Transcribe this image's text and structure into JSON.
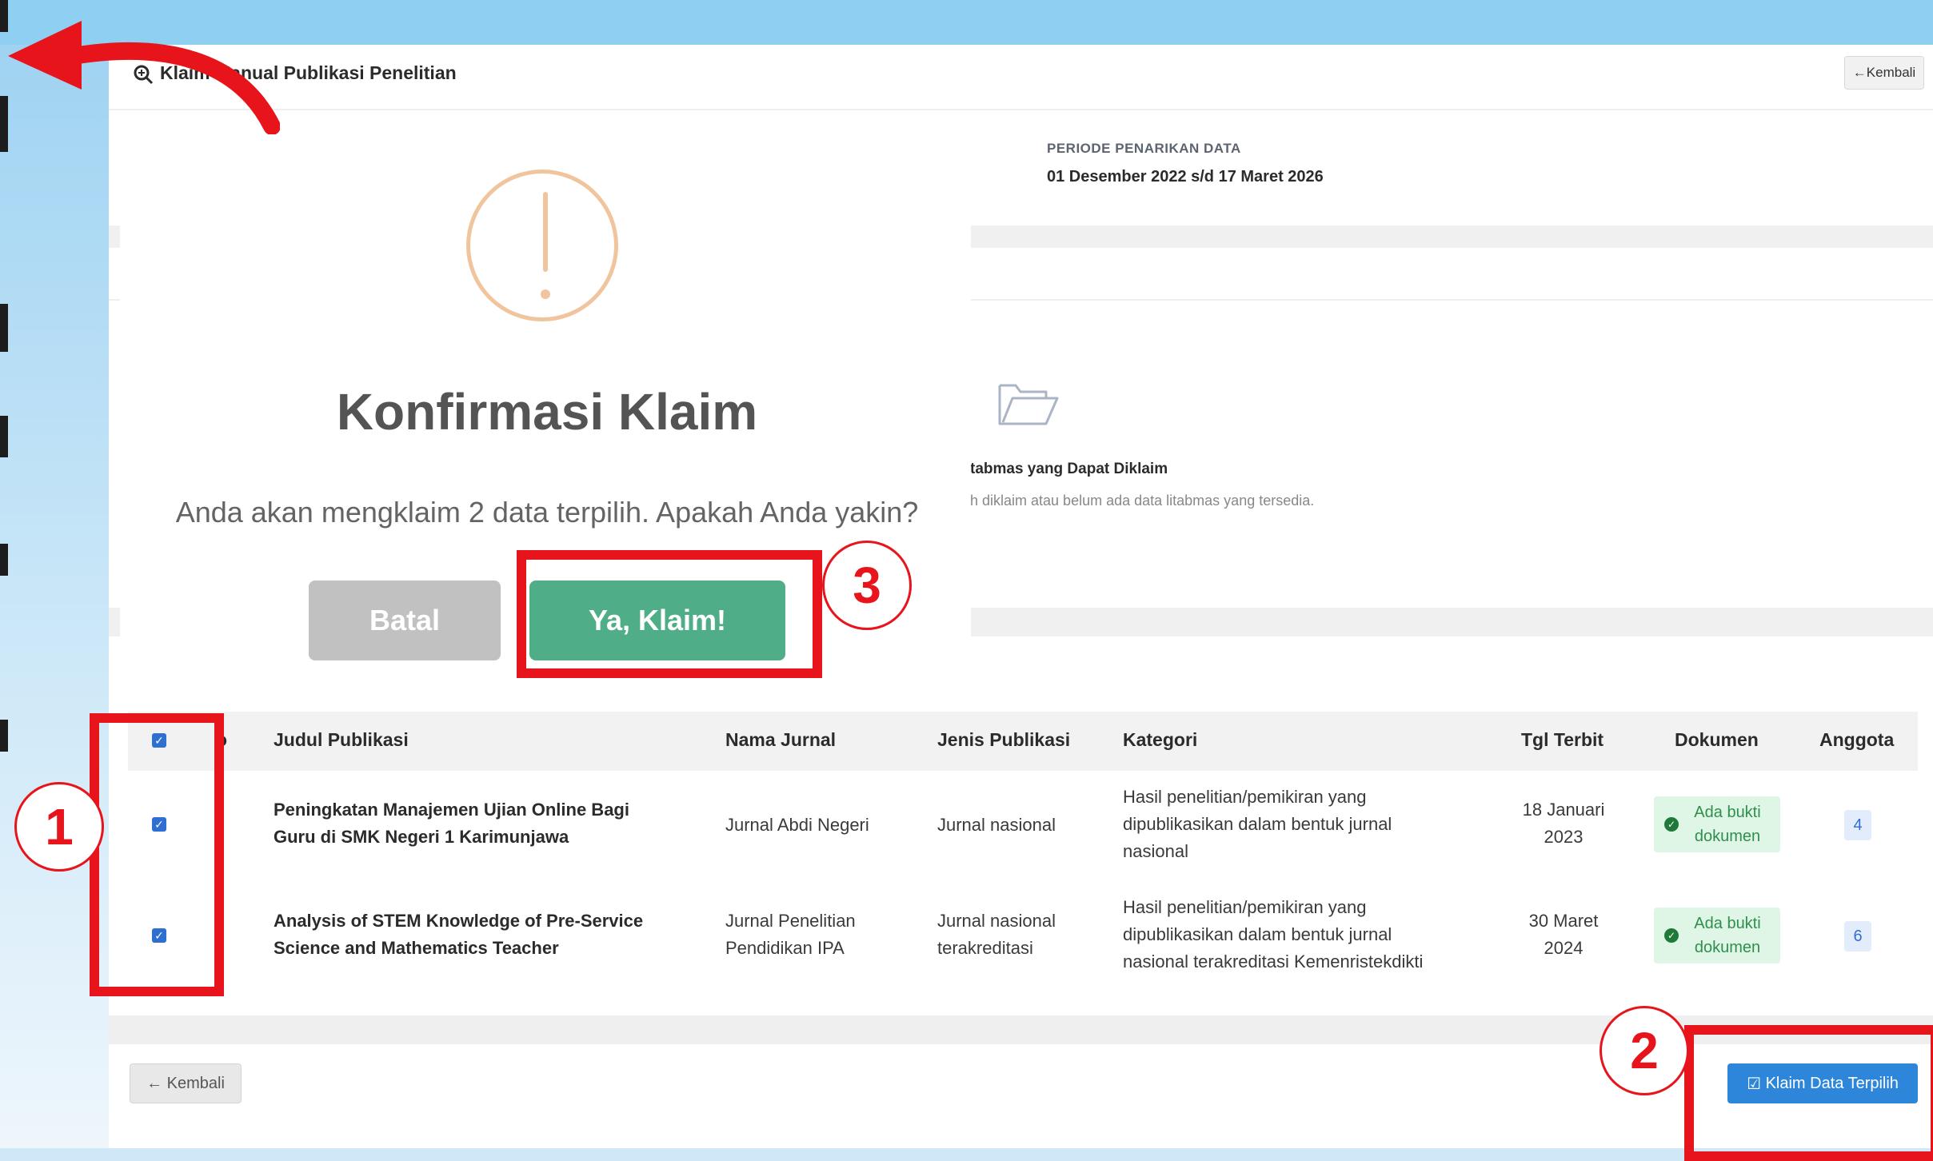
{
  "header": {
    "title": "Klaim Manual Publikasi Penelitian",
    "back_label": "Kembali"
  },
  "periode": {
    "label": "PERIODE PENARIKAN DATA",
    "value": "01 Desember 2022 s/d 17 Maret 2026"
  },
  "empty_state": {
    "title": "tabmas yang Dapat Diklaim",
    "description": "h diklaim atau belum ada data litabmas yang tersedia."
  },
  "modal": {
    "title": "Konfirmasi Klaim",
    "message": "Anda akan mengklaim 2 data terpilih. Apakah Anda yakin?",
    "cancel_label": "Batal",
    "confirm_label": "Ya, Klaim!"
  },
  "table": {
    "headers": {
      "no": "o",
      "judul": "Judul Publikasi",
      "jurnal": "Nama Jurnal",
      "jenis": "Jenis Publikasi",
      "kategori": "Kategori",
      "tgl": "Tgl Terbit",
      "dokumen": "Dokumen",
      "anggota": "Anggota"
    },
    "rows": [
      {
        "judul": [
          "Peningkatan Manajemen Ujian Online Bagi",
          "Guru di SMK Negeri 1 Karimunjawa"
        ],
        "jurnal": [
          "Jurnal Abdi Negeri"
        ],
        "jenis": [
          "Jurnal nasional"
        ],
        "kategori": [
          "Hasil penelitian/pemikiran yang",
          "dipublikasikan dalam bentuk jurnal",
          "nasional"
        ],
        "tgl": [
          "18 Januari",
          "2023"
        ],
        "dokumen": [
          "Ada bukti",
          "dokumen"
        ],
        "anggota": "4"
      },
      {
        "judul": [
          "Analysis of STEM Knowledge of Pre-Service",
          "Science and Mathematics Teacher"
        ],
        "jurnal": [
          "Jurnal Penelitian",
          "Pendidikan IPA"
        ],
        "jenis": [
          "Jurnal nasional",
          "terakreditasi"
        ],
        "kategori": [
          "Hasil penelitian/pemikiran yang",
          "dipublikasikan dalam bentuk jurnal",
          "nasional terakreditasi Kemenristekdikti"
        ],
        "tgl": [
          "30 Maret",
          "2024"
        ],
        "dokumen": [
          "Ada bukti",
          "dokumen"
        ],
        "anggota": "6"
      }
    ]
  },
  "footer": {
    "back_label": "Kembali",
    "claim_label": "Klaim Data Terpilih"
  },
  "annotations": {
    "step1": "1",
    "step2": "2",
    "step3": "3"
  },
  "colors": {
    "annotation_red": "#e8141c",
    "confirm_green": "#4fae87",
    "primary_blue": "#2d86d9",
    "warning_orange": "#f0c59d"
  },
  "icons": {
    "header": "search-icon",
    "empty": "folder-open-icon",
    "warning": "exclamation-icon",
    "document_ok": "check-circle-icon",
    "claim": "check-square-icon",
    "back": "arrow-left-icon"
  }
}
